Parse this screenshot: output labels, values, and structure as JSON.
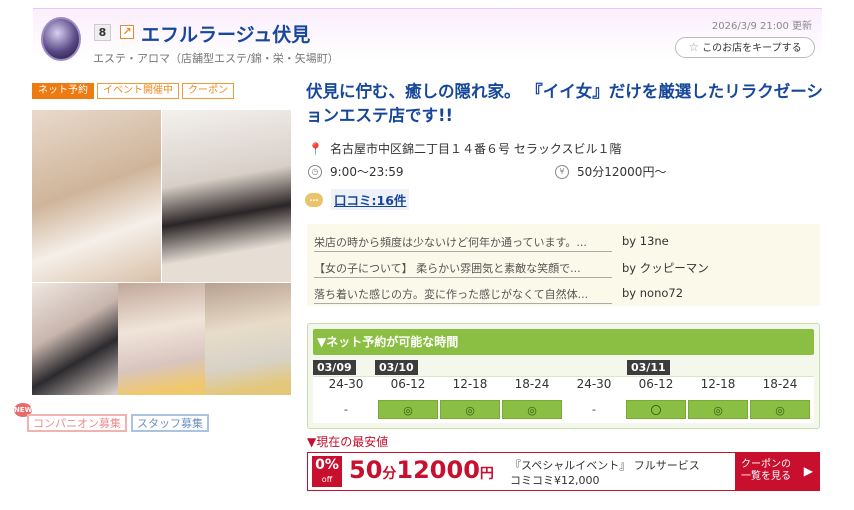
{
  "header": {
    "rank": "8",
    "shop_name": "エフルラージュ伏見",
    "genre": "エステ・アロマ（店舗型エステ/錦・栄・矢場町）",
    "updated": "2026/3/9 21:00 更新",
    "keep_label": "このお店をキープする"
  },
  "tags": [
    "ネット予約",
    "イベント開催中",
    "クーポン"
  ],
  "recruit": {
    "companion": "コンパニオン募集",
    "staff": "スタッフ募集",
    "new": "NEW"
  },
  "catch_copy": "伏見に佇む、癒しの隠れ家。 『イイ女』だけを厳選したリラクゼーションエステ店です!!",
  "info": {
    "address": "名古屋市中区錦二丁目１４番６号 セラックスビル１階",
    "hours": "9:00〜23:59",
    "price": "50分12000円〜",
    "yen_icon": "¥"
  },
  "review_link": "口コミ:16件",
  "reviews": [
    {
      "text": "栄店の時から頻度は少ないけど何年か通っています。...",
      "by": "by 13ne"
    },
    {
      "text": "【女の子について】 柔らかい雰囲気と素敵な笑顔で...",
      "by": "by クッピーマン"
    },
    {
      "text": "落ち着いた感じの方。変に作った感じがなくて自然体...",
      "by": "by nono72"
    }
  ],
  "reservation": {
    "title": "▼ネット予約が可能な時間",
    "dates": [
      "03/09",
      "03/10",
      "03/11"
    ],
    "slots": [
      {
        "label": "24-30",
        "status": "-"
      },
      {
        "label": "06-12",
        "status": "◎"
      },
      {
        "label": "12-18",
        "status": "◎"
      },
      {
        "label": "18-24",
        "status": "◎"
      },
      {
        "label": "24-30",
        "status": "-"
      },
      {
        "label": "06-12",
        "status": "〇"
      },
      {
        "label": "12-18",
        "status": "◎"
      },
      {
        "label": "18-24",
        "status": "◎"
      }
    ]
  },
  "lowest_price": {
    "title": "▼現在の最安値",
    "off_pct": "0%",
    "off_label": "off",
    "minutes": "50",
    "minutes_unit": "分",
    "price": "12000",
    "price_unit": "円",
    "desc_line1": "『スペシャルイベント』 フルサービス",
    "desc_line2": "コミコミ¥12,000",
    "coupon_line1": "クーポンの",
    "coupon_line2": "一覧を見る",
    "coupon_arrow": "▶"
  },
  "colors": {
    "brand_blue": "#16479b",
    "accent_orange": "#ee7a12",
    "reserve_green": "#8bbf44",
    "price_red": "#c8102e"
  }
}
